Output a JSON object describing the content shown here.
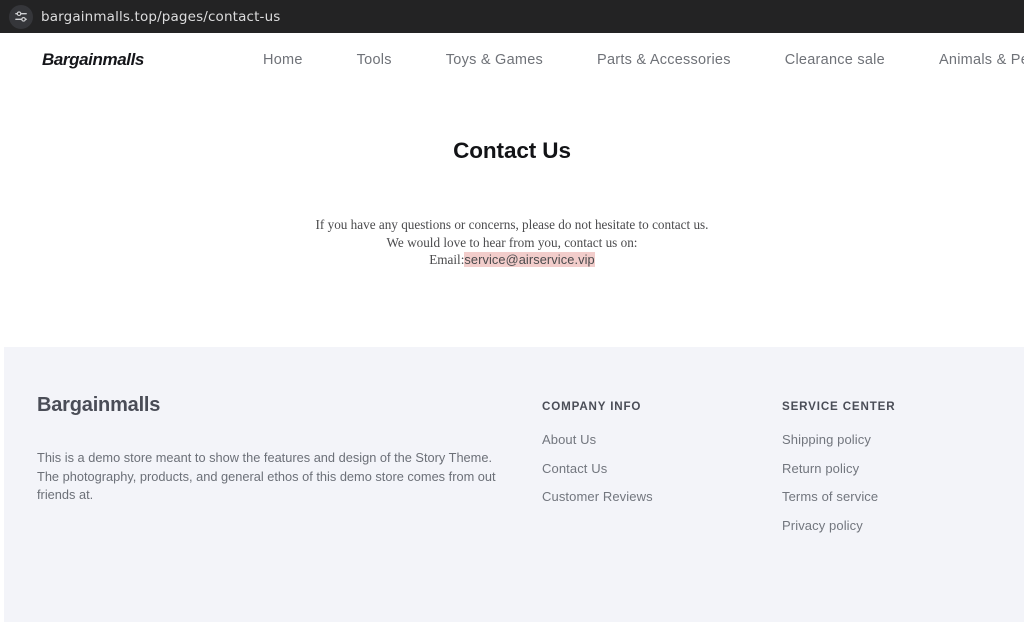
{
  "browser": {
    "site_settings_icon": "sliders-icon",
    "url": "bargainmalls.top/pages/contact-us"
  },
  "header": {
    "logo_text": "Bargainmalls",
    "nav": [
      {
        "label": "Home"
      },
      {
        "label": "Tools"
      },
      {
        "label": "Toys & Games"
      },
      {
        "label": "Parts & Accessories"
      },
      {
        "label": "Clearance sale"
      },
      {
        "label": "Animals & Pet Supplies"
      }
    ]
  },
  "main": {
    "page_title": "Contact Us",
    "paragraph_line_1": "If you have any questions or concerns, please do not hesitate to contact us.",
    "paragraph_line_2": "We would love to hear from you, contact us on:",
    "email_label": "Email:",
    "email_value": "service@airservice.vip",
    "email_highlight_color": "#f2cdcb"
  },
  "footer": {
    "background_color": "#f3f4f9",
    "brand": "Bargainmalls",
    "description": "This is a demo store meant to show the features and design of the Story Theme. The photography, products, and general ethos of this demo store comes from out friends at.",
    "columns": [
      {
        "heading": "Company Info",
        "links": [
          {
            "label": "About Us"
          },
          {
            "label": "Contact Us"
          },
          {
            "label": "Customer Reviews"
          }
        ]
      },
      {
        "heading": "Service Center",
        "links": [
          {
            "label": "Shipping policy"
          },
          {
            "label": "Return policy"
          },
          {
            "label": "Terms of service"
          },
          {
            "label": "Privacy policy"
          }
        ]
      }
    ]
  }
}
